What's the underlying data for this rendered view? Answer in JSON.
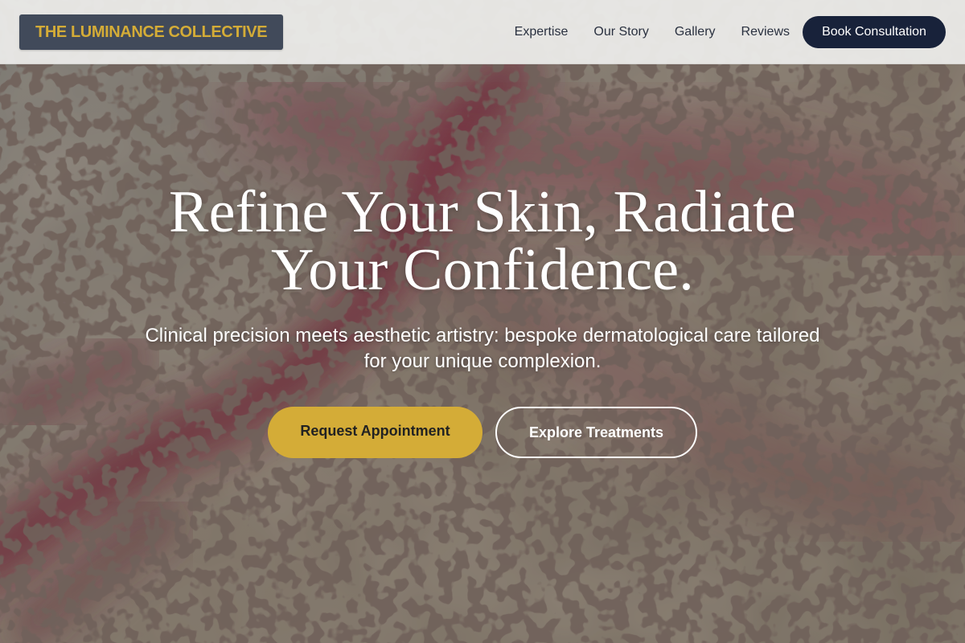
{
  "header": {
    "brand": "THE LUMINANCE COLLECTIVE",
    "nav": [
      {
        "label": "Expertise"
      },
      {
        "label": "Our Story"
      },
      {
        "label": "Gallery"
      },
      {
        "label": "Reviews"
      }
    ],
    "cta_label": "Book Consultation"
  },
  "hero": {
    "title": "Refine Your Skin, Radiate Your Confidence.",
    "subtitle": "Clinical precision meets aesthetic artistry: bespoke dermatological care tailored for your unique complexion.",
    "primary_button": "Request Appointment",
    "secondary_button": "Explore Treatments"
  },
  "colors": {
    "brand_gold": "#d4ac37",
    "logo_bg": "#414a5a",
    "navy": "#18223a",
    "header_bg": "#ecece9",
    "texture_base": "#8a8274",
    "texture_crimson": "#7a2438"
  }
}
